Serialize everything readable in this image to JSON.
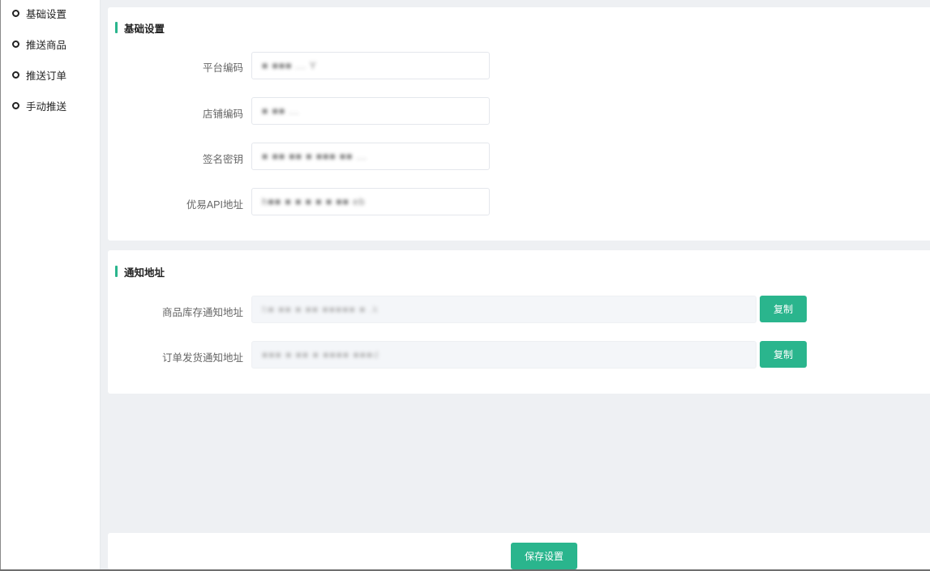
{
  "sidebar": {
    "items": [
      {
        "label": "基础设置"
      },
      {
        "label": "推送商品"
      },
      {
        "label": "推送订单"
      },
      {
        "label": "手动推送"
      }
    ]
  },
  "basic_settings": {
    "title": "基础设置",
    "fields": [
      {
        "label": "平台编码",
        "value": "■ ■■■ ... Y"
      },
      {
        "label": "店铺编码",
        "value": "■ ■■ ..."
      },
      {
        "label": "签名密钥",
        "value": "■ ■■ ■■ ■ ■■■ ■■ ..."
      },
      {
        "label": "优易API地址",
        "value": "h■■ ■ ■ ■ ■ ■ ■■ eb"
      }
    ]
  },
  "notify_settings": {
    "title": "通知地址",
    "copy_label": "复制",
    "fields": [
      {
        "label": "商品库存通知地址",
        "value": "h■ ■■ ■ ■■ ■■■■■ ■ .k"
      },
      {
        "label": "订单发货通知地址",
        "value": "■■■ ■ ■■ ■ ■■■■ ■■■d"
      }
    ]
  },
  "footer": {
    "save_label": "保存设置"
  },
  "colors": {
    "accent": "#2ab58d",
    "page_bg": "#eef0f3"
  }
}
